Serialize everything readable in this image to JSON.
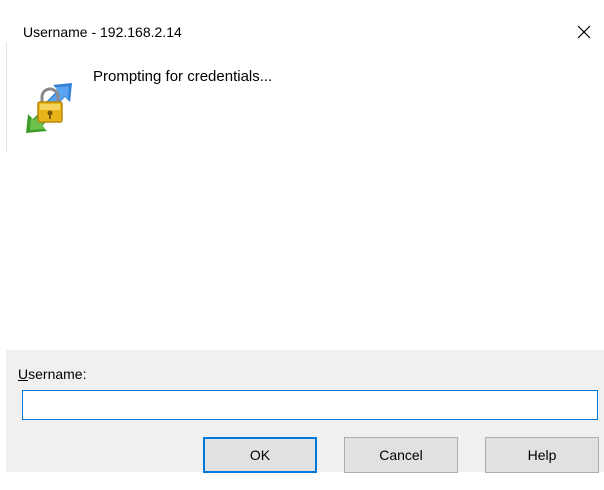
{
  "window": {
    "title": "Username - 192.168.2.14"
  },
  "icons": {
    "close": "close-icon",
    "app": "credentials-lock-icon"
  },
  "content": {
    "prompt": "Prompting for credentials..."
  },
  "form": {
    "label_accel": "U",
    "label_rest": "sername:",
    "value": ""
  },
  "buttons": {
    "ok": "OK",
    "cancel": "Cancel",
    "help": "Help"
  },
  "colors": {
    "accent": "#0078d7",
    "panel": "#f0f0f0",
    "button": "#e1e1e1"
  }
}
